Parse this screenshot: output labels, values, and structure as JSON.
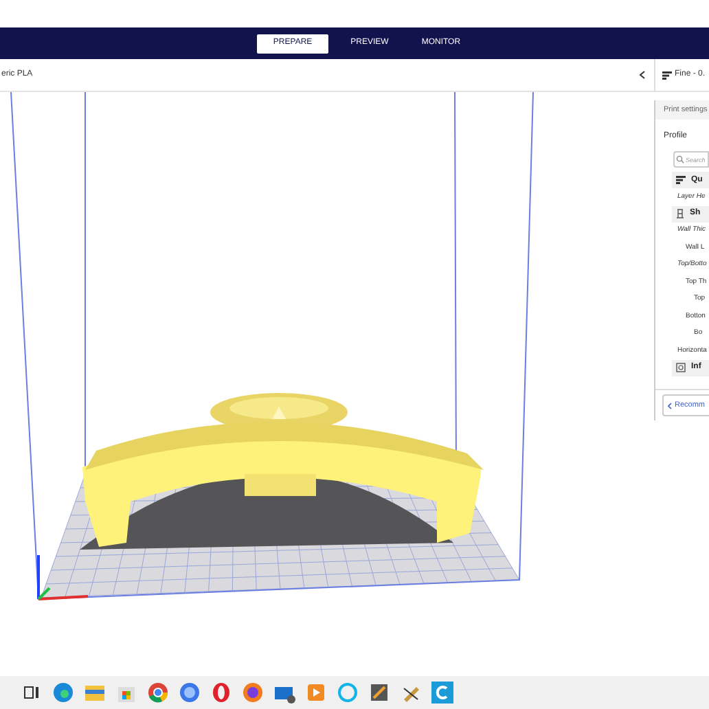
{
  "stage_tabs": [
    {
      "label": "PREPARE",
      "selected": true
    },
    {
      "label": "PREVIEW",
      "selected": false
    },
    {
      "label": "MONITOR",
      "selected": false
    }
  ],
  "material": "eric PLA",
  "profile_button": "Fine - 0.",
  "print_settings": {
    "title": "Print settings",
    "profile_label": "Profile",
    "search": {
      "placeholder": "Search"
    },
    "settings": [
      {
        "kind": "category",
        "label": "Qu"
      },
      {
        "kind": "setting",
        "label": "Layer He",
        "overridden": true
      },
      {
        "kind": "category",
        "label": "Sh"
      },
      {
        "kind": "setting",
        "label": "Wall Thic",
        "overridden": true,
        "children": [
          {
            "kind": "setting",
            "label": "Wall L",
            "overridden": false
          }
        ]
      },
      {
        "kind": "setting",
        "label": "Top/Botto",
        "overridden": true,
        "children": [
          {
            "kind": "setting",
            "label": "Top Th",
            "overridden": false,
            "children": [
              {
                "kind": "setting",
                "label": "Top",
                "overridden": false
              }
            ]
          },
          {
            "kind": "setting",
            "label": "Botton",
            "overridden": false,
            "children": [
              {
                "kind": "setting",
                "label": "Bo",
                "overridden": false
              }
            ]
          }
        ]
      },
      {
        "kind": "setting",
        "label": "Horizonta",
        "overridden": false
      },
      {
        "kind": "category",
        "label": "Inf"
      }
    ],
    "recommended_button": "Recomm"
  }
}
